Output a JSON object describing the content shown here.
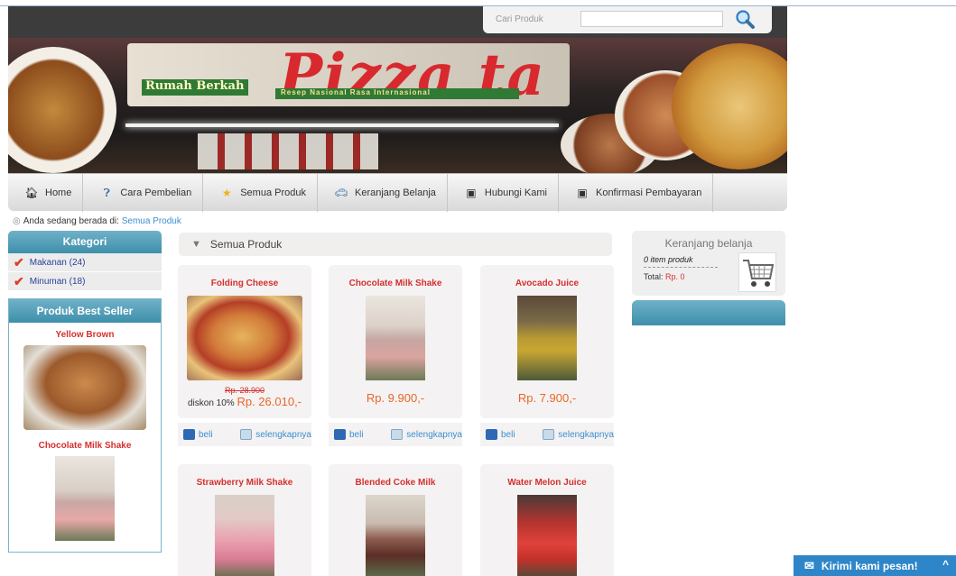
{
  "search": {
    "label": "Cari Produk",
    "placeholder": ""
  },
  "banner": {
    "title": "Pizza ta",
    "brand": "Rumah Berkah",
    "tagline": "Resep Nasional Rasa Internasional"
  },
  "nav": [
    {
      "label": "Home",
      "icon": "home-icon"
    },
    {
      "label": "Cara Pembelian",
      "icon": "help-icon"
    },
    {
      "label": "Semua Produk",
      "icon": "star-icon"
    },
    {
      "label": "Keranjang Belanja",
      "icon": "car-icon"
    },
    {
      "label": "Hubungi Kami",
      "icon": "contact-icon"
    },
    {
      "label": "Konfirmasi Pembayaran",
      "icon": "confirm-icon"
    }
  ],
  "breadcrumb": {
    "prefix": "Anda sedang berada di:",
    "current": "Semua Produk"
  },
  "sidebar": {
    "kategori_title": "Kategori",
    "categories": [
      {
        "label": "Makanan (24)"
      },
      {
        "label": "Minuman (18)"
      }
    ],
    "bestseller_title": "Produk Best Seller",
    "bestsellers": [
      {
        "name": "Yellow Brown"
      },
      {
        "name": "Chocolate Milk Shake"
      }
    ]
  },
  "main": {
    "title": "Semua Produk",
    "buy_label": "beli",
    "more_label": "selengkapnya",
    "products": [
      {
        "name": "Folding Cheese",
        "old_price": "Rp. 28.900",
        "discount_label": "diskon 10%",
        "price": "Rp. 26.010,-"
      },
      {
        "name": "Chocolate Milk Shake",
        "price": "Rp. 9.900,-"
      },
      {
        "name": "Avocado Juice",
        "price": "Rp. 7.900,-"
      },
      {
        "name": "Strawberry Milk Shake"
      },
      {
        "name": "Blended Coke Milk"
      },
      {
        "name": "Water Melon Juice"
      }
    ]
  },
  "cart": {
    "title": "Keranjang belanja",
    "items": "0 item produk",
    "total_label": "Total:",
    "total_value": "Rp. 0"
  },
  "chat": {
    "label": "Kirimi kami pesan!"
  }
}
